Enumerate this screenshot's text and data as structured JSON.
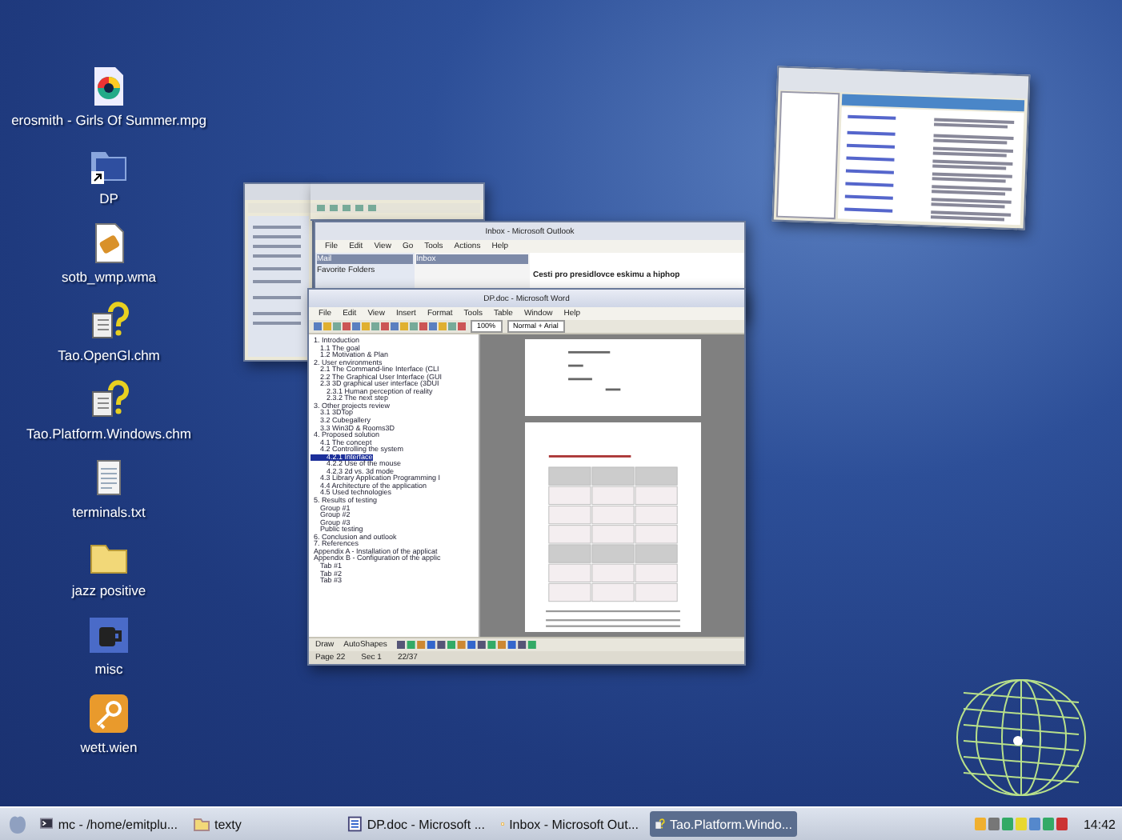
{
  "desktop_icons": [
    {
      "label": "erosmith - Girls Of Summer.mpg",
      "kind": "video"
    },
    {
      "label": "DP",
      "kind": "shortcut"
    },
    {
      "label": "sotb_wmp.wma",
      "kind": "audio"
    },
    {
      "label": "Tao.OpenGl.chm",
      "kind": "help"
    },
    {
      "label": "Tao.Platform.Windows.chm",
      "kind": "help"
    },
    {
      "label": "terminals.txt",
      "kind": "text"
    },
    {
      "label": "jazz positive",
      "kind": "folder"
    },
    {
      "label": "misc",
      "kind": "app"
    },
    {
      "label": "wett.wien",
      "kind": "key"
    }
  ],
  "outlook_window": {
    "title": "Inbox - Microsoft Outlook",
    "menu": [
      "File",
      "Edit",
      "View",
      "Go",
      "Tools",
      "Actions",
      "Help"
    ],
    "panes": [
      "Mail",
      "Inbox"
    ],
    "folders_header": "Favorite Folders",
    "message_subject": "Cesti pro presidlovce eskimu a hiphop"
  },
  "word_window": {
    "title": "DP.doc - Microsoft Word",
    "menu": [
      "File",
      "Edit",
      "View",
      "Insert",
      "Format",
      "Tools",
      "Table",
      "Window",
      "Help"
    ],
    "zoom": "100%",
    "style": "Normal + Arial",
    "outline": [
      {
        "label": "1. Introduction",
        "selected": false,
        "children": [
          {
            "label": "1.1 The goal",
            "selected": false
          },
          {
            "label": "1.2 Motivation & Plan",
            "selected": false
          }
        ]
      },
      {
        "label": "2. User environments",
        "selected": false,
        "children": [
          {
            "label": "2.1 The Command-line Interface (CLI",
            "selected": false
          },
          {
            "label": "2.2 The Graphical User Interface (GUI",
            "selected": false
          },
          {
            "label": "2.3 3D graphical user interface (3DUI",
            "selected": false,
            "children": [
              {
                "label": "2.3.1 Human perception of reality",
                "selected": false
              },
              {
                "label": "2.3.2 The next step",
                "selected": false
              }
            ]
          }
        ]
      },
      {
        "label": "3. Other projects review",
        "selected": false,
        "children": [
          {
            "label": "3.1 3DTop",
            "selected": false
          },
          {
            "label": "3.2 Cubegallery",
            "selected": false
          },
          {
            "label": "3.3 Win3D & Rooms3D",
            "selected": false
          }
        ]
      },
      {
        "label": "4. Proposed solution",
        "selected": false,
        "children": [
          {
            "label": "4.1 The concept",
            "selected": false
          },
          {
            "label": "4.2 Controlling the system",
            "selected": false,
            "children": [
              {
                "label": "4.2.1 Interface",
                "selected": true
              },
              {
                "label": "4.2.2 Use of the mouse",
                "selected": false
              },
              {
                "label": "4.2.3 2d vs. 3d mode",
                "selected": false
              }
            ]
          },
          {
            "label": "4.3 Library Application Programming I",
            "selected": false
          },
          {
            "label": "4.4 Architecture of the application",
            "selected": false
          },
          {
            "label": "4.5 Used technologies",
            "selected": false
          }
        ]
      },
      {
        "label": "5. Results of testing",
        "selected": false,
        "children": [
          {
            "label": "Group #1",
            "selected": false
          },
          {
            "label": "Group #2",
            "selected": false
          },
          {
            "label": "Group #3",
            "selected": false
          },
          {
            "label": "Public testing",
            "selected": false
          }
        ]
      },
      {
        "label": "6. Conclusion and outlook",
        "selected": false
      },
      {
        "label": "7. References",
        "selected": false
      },
      {
        "label": "Appendix A - Installation of the applicat",
        "selected": false
      },
      {
        "label": "Appendix B - Configuration of the applic",
        "selected": false,
        "children": [
          {
            "label": "Tab #1",
            "selected": false
          },
          {
            "label": "Tab #2",
            "selected": false
          },
          {
            "label": "Tab #3",
            "selected": false
          }
        ]
      }
    ],
    "draw_label": "Draw",
    "autoshapes_label": "AutoShapes",
    "status": [
      "Page 22",
      "Sec 1",
      "22/37"
    ]
  },
  "taskbar": {
    "items": [
      {
        "label": "mc - /home/emitplu...",
        "kind": "terminal",
        "selected": false
      },
      {
        "label": "texty",
        "kind": "folder",
        "selected": false
      },
      {
        "label": "DP.doc - Microsoft ...",
        "kind": "word",
        "selected": false
      },
      {
        "label": "Inbox - Microsoft Out...",
        "kind": "mail",
        "selected": false
      },
      {
        "label": "Tao.Platform.Windo...",
        "kind": "help",
        "selected": true
      }
    ],
    "clock": "14:42"
  }
}
